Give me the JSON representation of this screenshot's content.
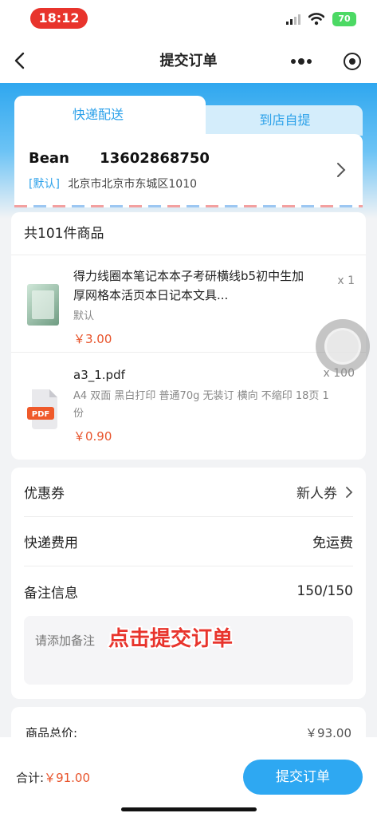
{
  "status_bar": {
    "time": "18:12",
    "battery": "70"
  },
  "nav": {
    "title": "提交订单"
  },
  "delivery_tabs": {
    "active": "快递配送",
    "inactive": "到店自提"
  },
  "address": {
    "name": "Bean",
    "phone": "13602868750",
    "tag": "[默认]",
    "detail": "北京市北京市东城区1010"
  },
  "products": {
    "header": "共101件商品",
    "items": [
      {
        "name": "得力线圈本笔记本本子考研横线b5初中生加厚网格本活页本日记本文具...",
        "spec": "默认",
        "price": "￥3.00",
        "qty": "x 1",
        "icon": "notebook-thumbnail"
      },
      {
        "name": "a3_1.pdf",
        "spec": "A4 双面 黑白打印 普通70g 无装订 横向 不缩印 18页 1份",
        "price": "￥0.90",
        "qty": "x 100",
        "icon": "pdf-icon"
      }
    ]
  },
  "options": {
    "coupon_label": "优惠券",
    "coupon_value": "新人券",
    "shipping_label": "快递费用",
    "shipping_value": "免运费",
    "remark_label": "备注信息",
    "remark_count": "150/150",
    "remark_placeholder": "请添加备注"
  },
  "overlay_caption": "点击提交订单",
  "total": {
    "label": "商品总价:",
    "value": "￥93.00"
  },
  "bottom": {
    "sum_label": "合计:",
    "sum_value": "￥91.00",
    "submit_label": "提交订单"
  },
  "colors": {
    "accent": "#2ea8f2",
    "price": "#e8542c",
    "caption": "#e8342c"
  }
}
